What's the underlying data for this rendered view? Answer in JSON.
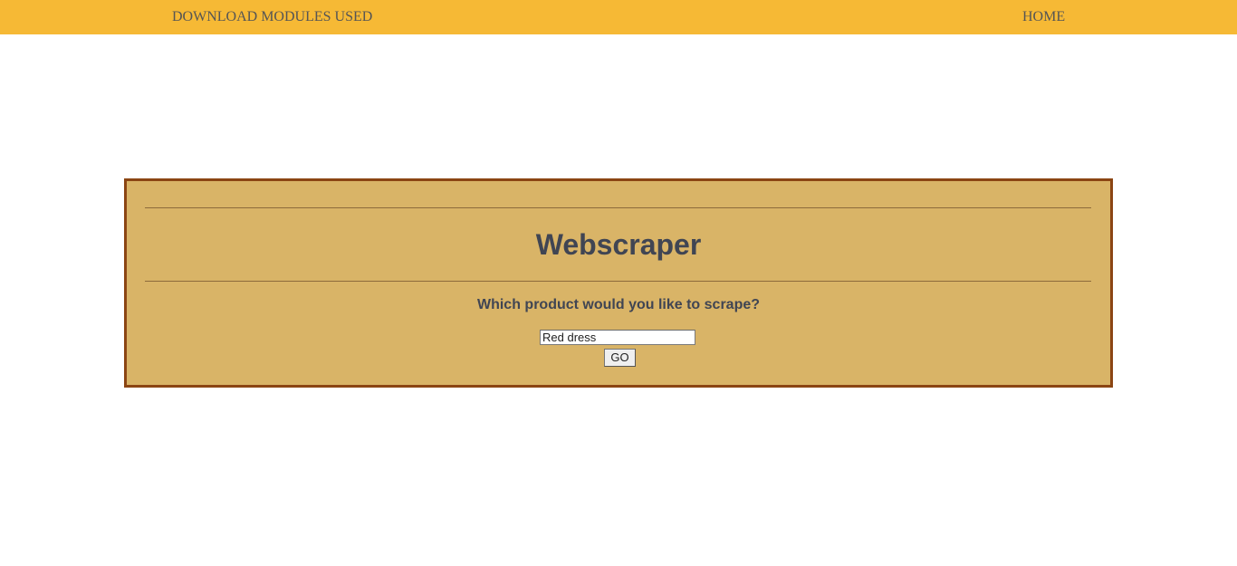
{
  "nav": {
    "download_label": "DOWNLOAD MODULES USED",
    "home_label": "HOME"
  },
  "main": {
    "title": "Webscraper",
    "question": "Which product would you like to scrape?",
    "search_value": "Red dress",
    "go_label": "GO"
  },
  "colors": {
    "nav_background": "#f6b935",
    "panel_background": "#d9b467",
    "panel_border": "#8b4513",
    "text": "#404553"
  }
}
